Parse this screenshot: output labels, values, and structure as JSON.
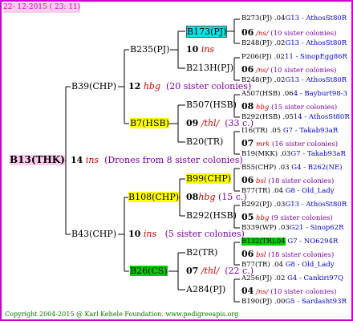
{
  "header": {
    "date": "22- 12-2015 ( 23: 11)"
  },
  "root": {
    "name": "B13(THK)",
    "year": "14",
    "origin": "ins",
    "sisters": "(Drones from 8 sister colonies)"
  },
  "g1": [
    {
      "name": "B39(CHP)",
      "year": "12",
      "origin": "hbg",
      "sisters": "(20 sister colonies)"
    },
    {
      "name": "B43(CHP)",
      "year": "10",
      "origin": "ins",
      "sisters": "(5 sister colonies)"
    }
  ],
  "g2": [
    {
      "name": "B235(PJ)",
      "year": "10",
      "origin": "ins",
      "sisters": ""
    },
    {
      "name": "B7(HSB)",
      "year": "09",
      "origin": "/thl/",
      "sisters": "(33 c.)"
    },
    {
      "name": "B108(CHP)",
      "year": "08",
      "origin": "hbg",
      "sisters": "(15 c.)"
    },
    {
      "name": "B26(CS)",
      "year": "07",
      "origin": "/thl/",
      "sisters": "(22 c.)"
    }
  ],
  "g3": [
    {
      "name": "B173(PJ)",
      "year": "06",
      "origin": "/ns/",
      "sisters": "(10 sister colonies)"
    },
    {
      "name": "B213H(PJ)",
      "year": "06",
      "origin": "/ns/",
      "sisters": "(10 sister colonies)"
    },
    {
      "name": "B507(HSB)",
      "year": "08",
      "origin": "hbg",
      "sisters": "(15 sister colonies)"
    },
    {
      "name": "B20(TR)",
      "year": "07",
      "origin": "mrk",
      "sisters": "(16 sister colonies)"
    },
    {
      "name": "B99(CHP)",
      "year": "06",
      "origin": "bsl",
      "sisters": "(18 sister colonies)"
    },
    {
      "name": "B292(HSB)",
      "year": "05",
      "origin": "hbg",
      "sisters": "(9 sister colonies)"
    },
    {
      "name": "B2(TR)",
      "year": "06",
      "origin": "bsl",
      "sisters": "(18 sister colonies)"
    },
    {
      "name": "A284(PJ)",
      "year": "04",
      "origin": "/ns/",
      "sisters": "(10 sister colonies)"
    }
  ],
  "g4": [
    {
      "name": "B273(PJ)",
      "year": ".04",
      "line": "G13 - AthosSt80R"
    },
    {
      "name": "B248(PJ)",
      "year": ".02",
      "line": "G13 - AthosSt80R"
    },
    {
      "name": "P206(PJ)",
      "year": ".02",
      "line": "11 - SinopEgg86R"
    },
    {
      "name": "B248(PJ)",
      "year": ".02",
      "line": "G13 - AthosSt80R"
    },
    {
      "name": "A507(HSB)",
      "year": ".06",
      "line": "4 - Bayburt98-3"
    },
    {
      "name": "B292(HSB)",
      "year": ".05",
      "line": "14 - AthosSt80R"
    },
    {
      "name": "I16(TR)",
      "year": ".05",
      "line": "G7 - Takab93aR"
    },
    {
      "name": "B19(MKK)",
      "year": ".03",
      "line": "G7 - Takab93aR"
    },
    {
      "name": "B55(CHP)",
      "year": ".03",
      "line": "G4 - B262(NE)"
    },
    {
      "name": "B77(TR)",
      "year": ".04",
      "line": "G8 - Old_Lady"
    },
    {
      "name": "B292(PJ)",
      "year": ".03",
      "line": "G13 - AthosSt80R"
    },
    {
      "name": "B339(WP)",
      "year": ".03",
      "line": "G21 - Sinop62R"
    },
    {
      "name": "B132(TR)",
      "year": ".04",
      "line": "G7 - NO6294R"
    },
    {
      "name": "B77(TR)",
      "year": ".04",
      "line": "G8 - Old_Lady"
    },
    {
      "name": "A256(PJ)",
      "year": ".02",
      "line": "G4 - Cankiri97Q"
    },
    {
      "name": "B190(PJ)",
      "year": ".00",
      "line": "G5 - Sardasht93R"
    }
  ],
  "footer": {
    "copyright": "Copyright 2004-2015 @ Karl Kehele Foundation.    www.pedigreeapis.org"
  }
}
